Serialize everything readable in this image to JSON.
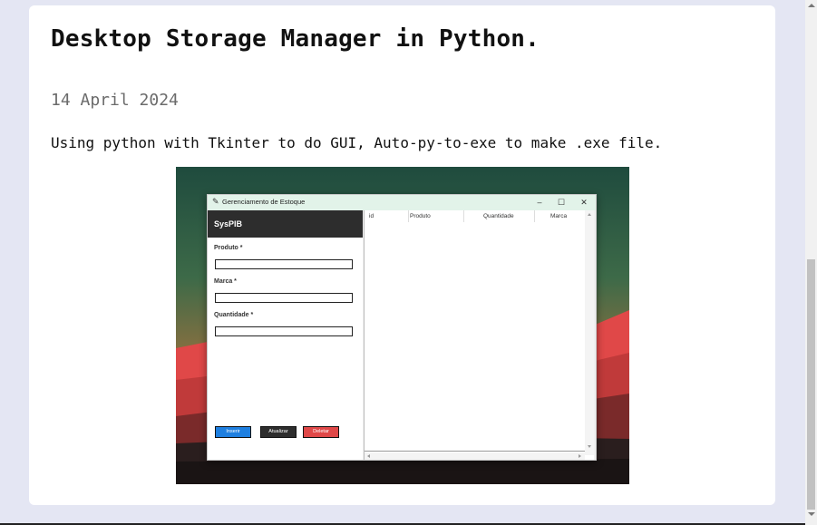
{
  "post": {
    "title": "Desktop Storage Manager in Python.",
    "date": "14 April 2024",
    "description": "Using python with Tkinter to do GUI, Auto-py-to-exe to make .exe file."
  },
  "screenshot_app": {
    "window_title": "Gerenciamento de Estoque",
    "window_buttons": {
      "minimize": "–",
      "maximize": "☐",
      "close": "✕"
    },
    "brand": "SysPIB",
    "fields": [
      {
        "label": "Produto *",
        "value": ""
      },
      {
        "label": "Marca *",
        "value": ""
      },
      {
        "label": "Quantidade *",
        "value": ""
      }
    ],
    "buttons": [
      {
        "label": "Inserir",
        "color": "#1e7fe0"
      },
      {
        "label": "Atualizar",
        "color": "#2d2d2d"
      },
      {
        "label": "Deletar",
        "color": "#e04848"
      }
    ],
    "table_columns": [
      "id",
      "Produto",
      "Quantidade",
      "Marca"
    ],
    "table_rows": []
  },
  "colors": {
    "page_background": "#e4e6f3",
    "card_background": "#ffffff",
    "date_text": "#6b6b6b"
  }
}
